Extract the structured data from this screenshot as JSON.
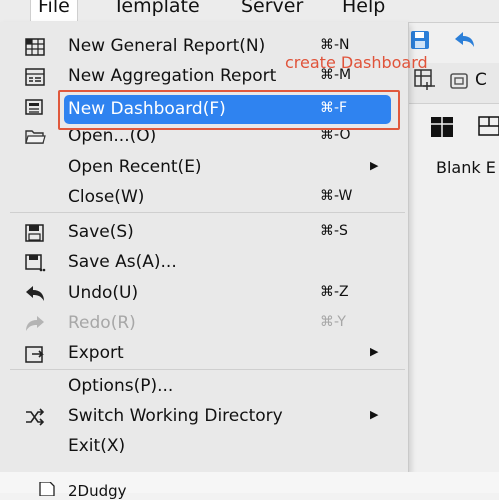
{
  "menubar": {
    "items": [
      {
        "label": "File"
      },
      {
        "label": "Template"
      },
      {
        "label": "Server"
      },
      {
        "label": "Help"
      }
    ]
  },
  "annotation": {
    "text": "create Dashboard",
    "color": "#e0533a"
  },
  "file_menu": {
    "items": [
      {
        "label": "New General Report(N)",
        "shortcut": "⌘-N",
        "icon": "grid-report-icon"
      },
      {
        "label": "New Aggregation Report",
        "shortcut": "⌘-M",
        "icon": "aggregation-report-icon"
      },
      {
        "label": "New Dashboard(F)",
        "shortcut": "⌘-F",
        "icon": "dashboard-icon",
        "highlighted": true
      },
      {
        "label": "Open...(O)",
        "shortcut": "⌘-O",
        "icon": "folder-open-icon"
      },
      {
        "label": "Open Recent(E)",
        "shortcut": "",
        "submenu": true
      },
      {
        "label": "Close(W)",
        "shortcut": "⌘-W"
      },
      {
        "label": "Save(S)",
        "shortcut": "⌘-S",
        "icon": "save-icon"
      },
      {
        "label": "Save As(A)...",
        "shortcut": "",
        "icon": "save-as-icon"
      },
      {
        "label": "Undo(U)",
        "shortcut": "⌘-Z",
        "icon": "undo-icon"
      },
      {
        "label": "Redo(R)",
        "shortcut": "⌘-Y",
        "icon": "redo-icon",
        "disabled": true
      },
      {
        "label": "Export",
        "shortcut": "",
        "icon": "export-icon",
        "submenu": true
      },
      {
        "label": "Options(P)...",
        "shortcut": ""
      },
      {
        "label": "Switch Working Directory",
        "shortcut": "",
        "icon": "shuffle-icon",
        "submenu": true
      },
      {
        "label": "Exit(X)",
        "shortcut": ""
      }
    ]
  },
  "right_panel": {
    "blank_label": "Blank E",
    "tab_partial": "C"
  },
  "bottom": {
    "label": "2Dudgy"
  },
  "colors": {
    "highlight": "#2f83f0",
    "annotation_border": "#e0583c",
    "toolbar_blue": "#2c7fd8"
  }
}
